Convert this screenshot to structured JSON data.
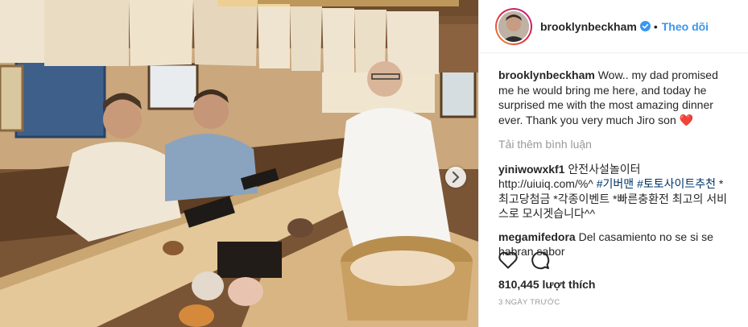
{
  "header": {
    "username": "brooklynbeckham",
    "separator": "•",
    "follow_label": "Theo dõi"
  },
  "caption": {
    "username": "brooklynbeckham",
    "text": "Wow.. my dad promised me he would bring me here, and today he surprised me with the most amazing dinner ever. Thank you very much Jiro son",
    "emoji": "❤️"
  },
  "load_more_label": "Tải thêm bình luận",
  "comments": [
    {
      "username": "yiniwowxkf1",
      "text_before": "안전사설놀이터 http://uiuiq.com/%^",
      "hashtags": "#기버맨 #토토사이트추천",
      "text_after": "*최고당첨금 *각종이벤트 *빠른충환전 최고의 서비스로 모시겟습니다^^"
    },
    {
      "username": "megamifedora",
      "text": "Del casamiento no se si se habran sabor"
    }
  ],
  "icons": {
    "like": "heart-icon",
    "comment": "comment-icon",
    "verified": "verified-badge-icon",
    "next": "chevron-right-icon"
  },
  "likes_label": "810,445 lượt thích",
  "timestamp": "3 ngày trước",
  "colors": {
    "link_blue": "#3897f0",
    "hashtag": "#003569",
    "muted": "#999999",
    "text": "#262626"
  }
}
